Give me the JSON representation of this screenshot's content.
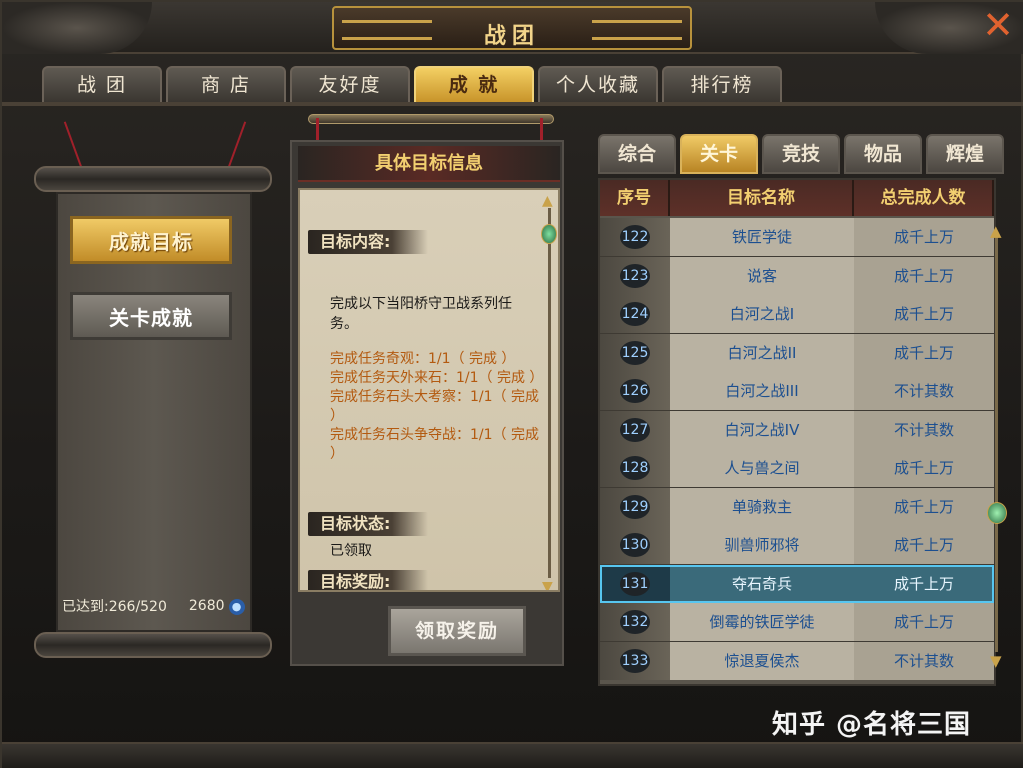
{
  "window": {
    "title": "战团",
    "close_glyph": "✕"
  },
  "main_tabs": [
    {
      "label": "战 团",
      "active": false
    },
    {
      "label": "商 店",
      "active": false
    },
    {
      "label": "友好度",
      "active": false
    },
    {
      "label": "成 就",
      "active": true
    },
    {
      "label": "个人收藏",
      "active": false
    },
    {
      "label": "排行榜",
      "active": false
    }
  ],
  "left_panel": {
    "buttons": [
      {
        "label": "成就目标",
        "active": true
      },
      {
        "label": "关卡成就",
        "active": false
      }
    ],
    "progress_label": "已达到:266/520",
    "points": "2680",
    "points_icon": "coin-icon"
  },
  "detail": {
    "header": "具体目标信息",
    "content_label": "目标内容:",
    "description": "完成以下当阳桥守卫战系列任务。",
    "tasks": [
      "完成任务奇观：1/1（ 完成 ）",
      "完成任务天外来石：1/1（ 完成 ）",
      "完成任务石头大考察：1/1（ 完成 ）",
      "完成任务石头争夺战：1/1（ 完成 ）"
    ],
    "state_label": "目标状态:",
    "state_value": "已领取",
    "reward_label": "目标奖励:",
    "claim_button": "领取奖励"
  },
  "right_panel": {
    "sub_tabs": [
      {
        "label": "综合",
        "active": false
      },
      {
        "label": "关卡",
        "active": true
      },
      {
        "label": "竞技",
        "active": false
      },
      {
        "label": "物品",
        "active": false
      },
      {
        "label": "辉煌",
        "active": false
      }
    ],
    "columns": [
      "序号",
      "目标名称",
      "总完成人数"
    ],
    "rows": [
      {
        "no": "122",
        "name": "铁匠学徒",
        "count": "成千上万"
      },
      {
        "no": "123",
        "name": "说客",
        "count": "成千上万"
      },
      {
        "no": "124",
        "name": "白河之战I",
        "count": "成千上万"
      },
      {
        "no": "125",
        "name": "白河之战II",
        "count": "成千上万"
      },
      {
        "no": "126",
        "name": "白河之战III",
        "count": "不计其数"
      },
      {
        "no": "127",
        "name": "白河之战IV",
        "count": "不计其数"
      },
      {
        "no": "128",
        "name": "人与兽之间",
        "count": "成千上万"
      },
      {
        "no": "129",
        "name": "单骑救主",
        "count": "成千上万"
      },
      {
        "no": "130",
        "name": "驯兽师邪将",
        "count": "成千上万"
      },
      {
        "no": "131",
        "name": "夺石奇兵",
        "count": "成千上万"
      },
      {
        "no": "132",
        "name": "倒霉的铁匠学徒",
        "count": "成千上万"
      },
      {
        "no": "133",
        "name": "惊退夏侯杰",
        "count": "不计其数"
      }
    ],
    "selected_row": 9
  },
  "watermark": "知乎 @名将三国",
  "colors": {
    "gold": "#f2cf70",
    "selected": "#57c6f0",
    "task_text": "#b35a10",
    "link": "#1c4f90"
  }
}
